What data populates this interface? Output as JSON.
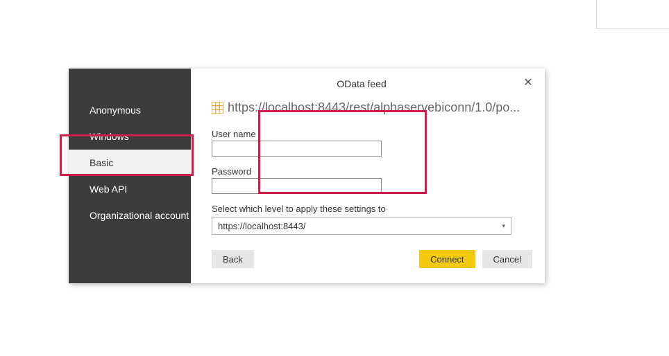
{
  "dialog": {
    "title": "OData feed",
    "url": "https://localhost:8443/rest/alphaservebiconn/1.0/po..."
  },
  "sidebar": {
    "items": [
      {
        "label": "Anonymous"
      },
      {
        "label": "Windows"
      },
      {
        "label": "Basic"
      },
      {
        "label": "Web API"
      },
      {
        "label": "Organizational account"
      }
    ]
  },
  "form": {
    "username_label": "User name",
    "username_value": "",
    "password_label": "Password",
    "password_value": "",
    "level_label": "Select which level to apply these settings to",
    "level_selected": "https://localhost:8443/"
  },
  "buttons": {
    "back": "Back",
    "connect": "Connect",
    "cancel": "Cancel"
  }
}
